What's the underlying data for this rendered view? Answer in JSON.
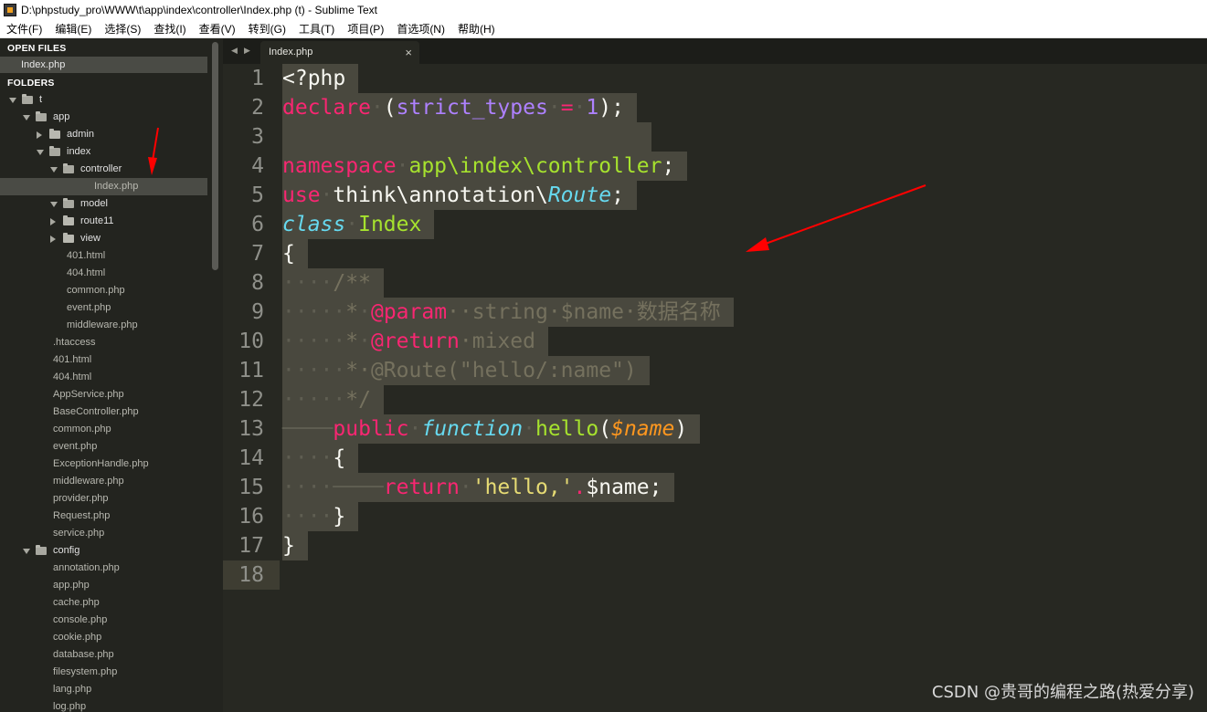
{
  "window": {
    "title": "D:\\phpstudy_pro\\WWW\\t\\app\\index\\controller\\Index.php (t) - Sublime Text"
  },
  "menu": [
    "文件(F)",
    "编辑(E)",
    "选择(S)",
    "查找(I)",
    "查看(V)",
    "转到(G)",
    "工具(T)",
    "项目(P)",
    "首选项(N)",
    "帮助(H)"
  ],
  "sidebar": {
    "open_files_title": "OPEN FILES",
    "open_files": [
      "Index.php"
    ],
    "folders_title": "FOLDERS",
    "tree": [
      {
        "label": "t",
        "type": "folder",
        "expanded": true
      },
      {
        "label": "app",
        "type": "folder",
        "expanded": true
      },
      {
        "label": "admin",
        "type": "folder",
        "expanded": false
      },
      {
        "label": "index",
        "type": "folder",
        "expanded": true
      },
      {
        "label": "controller",
        "type": "folder",
        "expanded": true
      },
      {
        "label": "Index.php",
        "type": "file",
        "selected": true
      },
      {
        "label": "model",
        "type": "folder",
        "expanded": true
      },
      {
        "label": "route11",
        "type": "folder",
        "expanded": false
      },
      {
        "label": "view",
        "type": "folder",
        "expanded": false
      },
      {
        "label": "401.html",
        "type": "file"
      },
      {
        "label": "404.html",
        "type": "file"
      },
      {
        "label": "common.php",
        "type": "file"
      },
      {
        "label": "event.php",
        "type": "file"
      },
      {
        "label": "middleware.php",
        "type": "file"
      },
      {
        "label": ".htaccess",
        "type": "file"
      },
      {
        "label": "401.html",
        "type": "file"
      },
      {
        "label": "404.html",
        "type": "file"
      },
      {
        "label": "AppService.php",
        "type": "file"
      },
      {
        "label": "BaseController.php",
        "type": "file"
      },
      {
        "label": "common.php",
        "type": "file"
      },
      {
        "label": "event.php",
        "type": "file"
      },
      {
        "label": "ExceptionHandle.php",
        "type": "file"
      },
      {
        "label": "middleware.php",
        "type": "file"
      },
      {
        "label": "provider.php",
        "type": "file"
      },
      {
        "label": "Request.php",
        "type": "file"
      },
      {
        "label": "service.php",
        "type": "file"
      },
      {
        "label": "config",
        "type": "folder",
        "expanded": true
      },
      {
        "label": "annotation.php",
        "type": "file"
      },
      {
        "label": "app.php",
        "type": "file"
      },
      {
        "label": "cache.php",
        "type": "file"
      },
      {
        "label": "console.php",
        "type": "file"
      },
      {
        "label": "cookie.php",
        "type": "file"
      },
      {
        "label": "database.php",
        "type": "file"
      },
      {
        "label": "filesystem.php",
        "type": "file"
      },
      {
        "label": "lang.php",
        "type": "file"
      },
      {
        "label": "log.php",
        "type": "file"
      }
    ]
  },
  "tabs": [
    {
      "label": "Index.php",
      "close": "×"
    }
  ],
  "editor": {
    "line_numbers": [
      "1",
      "2",
      "3",
      "4",
      "5",
      "6",
      "7",
      "8",
      "9",
      "10",
      "11",
      "12",
      "13",
      "14",
      "15",
      "16",
      "17",
      "18"
    ],
    "lines": [
      "<?php",
      "declare (strict_types = 1);",
      "",
      "namespace app\\index\\controller;",
      "use think\\annotation\\Route;",
      "class Index",
      "{",
      "    /**",
      "     * @param  string $name 数据名称",
      "     * @return mixed",
      "     * @Route(\"hello/:name\")",
      "     */",
      "    public function hello($name)",
      "    {",
      "        return 'hello,'.$name;",
      "    }",
      "}",
      ""
    ]
  },
  "watermark": "CSDN @贵哥的编程之路(热爱分享)",
  "colors": {
    "background": "#272822",
    "sidebar": "#23241f",
    "selection": "#49483e",
    "keyword": "#f92672",
    "string": "#e6db74",
    "function": "#a6e22e",
    "storage": "#66d9ef",
    "number": "#ae81ff",
    "comment": "#75715e",
    "annotation": "#ff0000"
  }
}
